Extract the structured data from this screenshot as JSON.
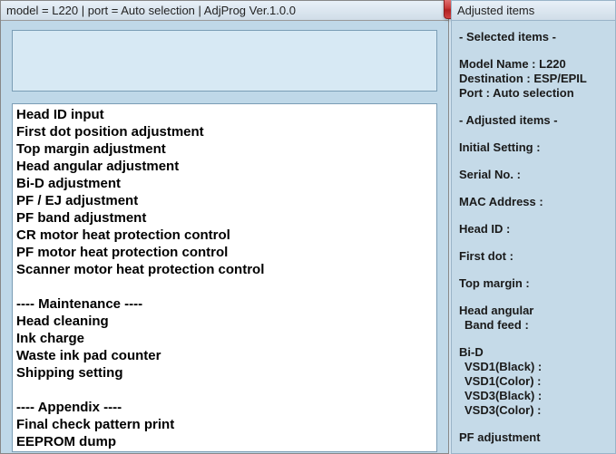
{
  "window": {
    "title": "model = L220 | port = Auto selection | AdjProg Ver.1.0.0",
    "close_label": "X"
  },
  "input": {
    "value": ""
  },
  "list": {
    "items": [
      "Head ID input",
      "First dot position adjustment",
      "Top margin adjustment",
      "Head angular adjustment",
      "Bi-D adjustment",
      "PF / EJ adjustment",
      "PF band adjustment",
      "CR motor heat protection control",
      "PF motor heat protection control",
      "Scanner motor heat protection control",
      "",
      "---- Maintenance ----",
      "Head cleaning",
      "Ink charge",
      "Waste ink pad counter",
      "Shipping setting",
      "",
      "---- Appendix ----",
      "Final check pattern print",
      "EEPROM dump"
    ]
  },
  "side": {
    "title": "Adjusted items",
    "sections": {
      "selected_header": "- Selected items -",
      "model": "Model Name : L220",
      "destination": "Destination : ESP/EPIL",
      "port": "Port : Auto selection",
      "adjusted_header": "- Adjusted items -",
      "initial": "Initial Setting :",
      "serial": "Serial No. :",
      "mac": "MAC Address :",
      "headid": "Head ID :",
      "firstdot": "First dot :",
      "topmargin": "Top margin :",
      "headang": "Head angular",
      "bandfeed": "Band feed :",
      "bid": "Bi-D",
      "vsd1b": "VSD1(Black) :",
      "vsd1c": "VSD1(Color) :",
      "vsd3b": "VSD3(Black) :",
      "vsd3c": "VSD3(Color) :",
      "pfadj": "PF adjustment"
    }
  }
}
